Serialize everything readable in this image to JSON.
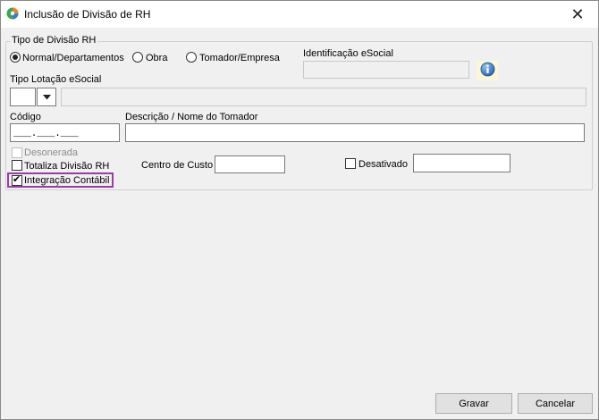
{
  "window": {
    "title": "Inclusão de Divisão de RH",
    "close_glyph": "✕"
  },
  "group": {
    "legend": "Tipo de Divisão RH",
    "radios": [
      {
        "label": "Normal/Departamentos",
        "checked": true
      },
      {
        "label": "Obra",
        "checked": false
      },
      {
        "label": "Tomador/Empresa",
        "checked": false
      }
    ]
  },
  "identificacao": {
    "label": "Identificação eSocial",
    "value": "",
    "info_icon": "info-icon"
  },
  "tipo_lotacao": {
    "label": "Tipo Lotação eSocial",
    "code_value": "",
    "description_value": "",
    "dropdown_icon": "chevron-down-icon"
  },
  "codigo": {
    "label": "Código",
    "mask": "___.___.___"
  },
  "descricao": {
    "label": "Descrição / Nome do Tomador",
    "value": ""
  },
  "checkboxes": {
    "desonerada": {
      "label": "Desonerada",
      "checked": false,
      "disabled": true
    },
    "totaliza": {
      "label": "Totaliza Divisão RH",
      "checked": false
    },
    "integracao": {
      "label": "Integração Contábil",
      "checked": true
    },
    "desativado": {
      "label": "Desativado",
      "checked": false
    }
  },
  "centro_custo": {
    "label": "Centro de Custo",
    "value": ""
  },
  "desativado_field": {
    "value": ""
  },
  "buttons": {
    "gravar": "Gravar",
    "cancelar": "Cancelar"
  },
  "colors": {
    "highlight": "#9b3ca8",
    "info_bg": "#fdf7d8"
  }
}
